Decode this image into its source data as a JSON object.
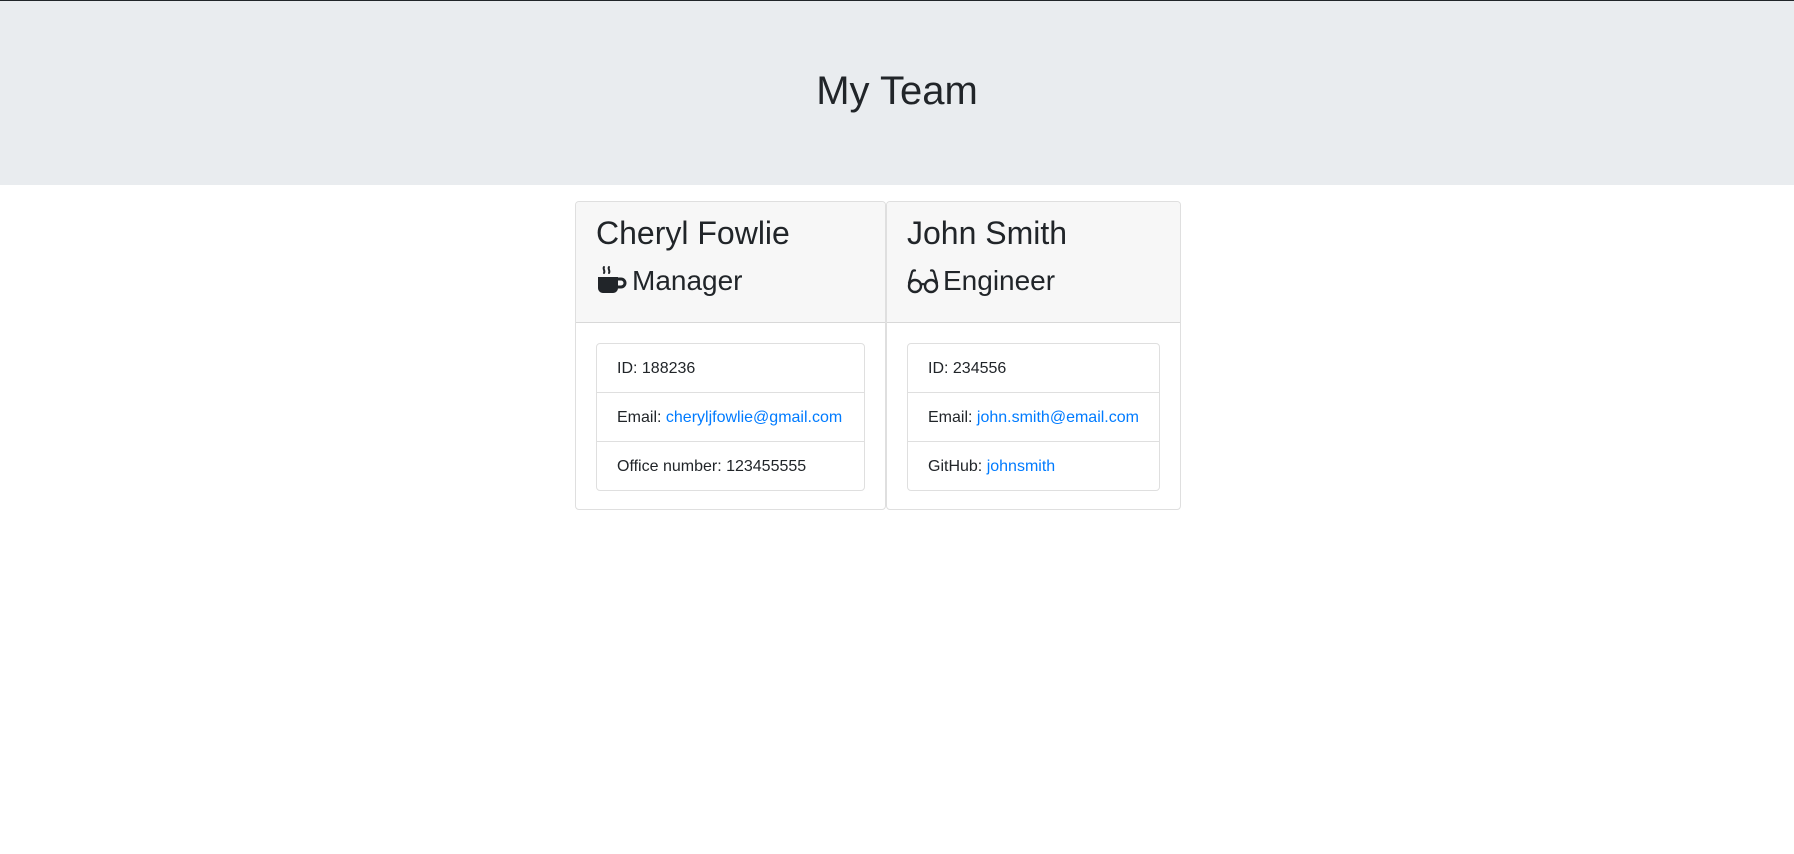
{
  "header": {
    "title": "My Team"
  },
  "colors": {
    "jumbotron_bg": "#e9ecef",
    "card_header_bg": "#f7f7f7",
    "link": "#007bff",
    "text": "#212529"
  },
  "employees": [
    {
      "name": "Cheryl Fowlie",
      "role": "Manager",
      "role_icon": "mug-hot-icon",
      "id_label": "ID: 188236",
      "email_prefix": "Email: ",
      "email": "cheryljfowlie@gmail.com",
      "extra_label": "Office number: 123455555"
    },
    {
      "name": "John Smith",
      "role": "Engineer",
      "role_icon": "glasses-icon",
      "id_label": "ID: 234556",
      "email_prefix": "Email: ",
      "email": "john.smith@email.com",
      "extra_prefix": "GitHub: ",
      "github": "johnsmith"
    }
  ]
}
